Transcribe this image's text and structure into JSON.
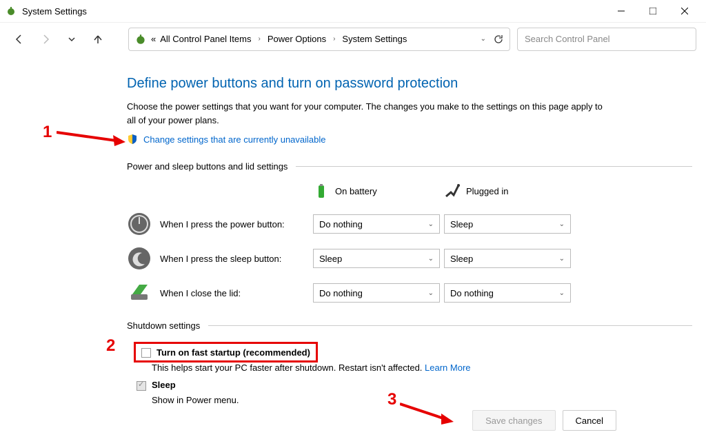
{
  "window": {
    "title": "System Settings"
  },
  "breadcrumb": {
    "prefix": "«",
    "items": [
      "All Control Panel Items",
      "Power Options",
      "System Settings"
    ]
  },
  "search": {
    "placeholder": "Search Control Panel"
  },
  "main": {
    "heading": "Define power buttons and turn on password protection",
    "description": "Choose the power settings that you want for your computer. The changes you make to the settings on this page apply to all of your power plans.",
    "change_link": "Change settings that are currently unavailable"
  },
  "sections": {
    "power_sleep": {
      "title": "Power and sleep buttons and lid settings",
      "columns": {
        "battery": "On battery",
        "plugged": "Plugged in"
      },
      "rows": [
        {
          "label": "When I press the power button:",
          "battery_value": "Do nothing",
          "plugged_value": "Sleep"
        },
        {
          "label": "When I press the sleep button:",
          "battery_value": "Sleep",
          "plugged_value": "Sleep"
        },
        {
          "label": "When I close the lid:",
          "battery_value": "Do nothing",
          "plugged_value": "Do nothing"
        }
      ]
    },
    "shutdown": {
      "title": "Shutdown settings",
      "fast_startup": {
        "label": "Turn on fast startup (recommended)",
        "desc_prefix": "This helps start your PC faster after shutdown. Restart isn't affected. ",
        "learn_more": "Learn More"
      },
      "sleep": {
        "label": "Sleep",
        "desc": "Show in Power menu."
      }
    }
  },
  "footer": {
    "save": "Save changes",
    "cancel": "Cancel"
  },
  "annotations": {
    "n1": "1",
    "n2": "2",
    "n3": "3"
  }
}
